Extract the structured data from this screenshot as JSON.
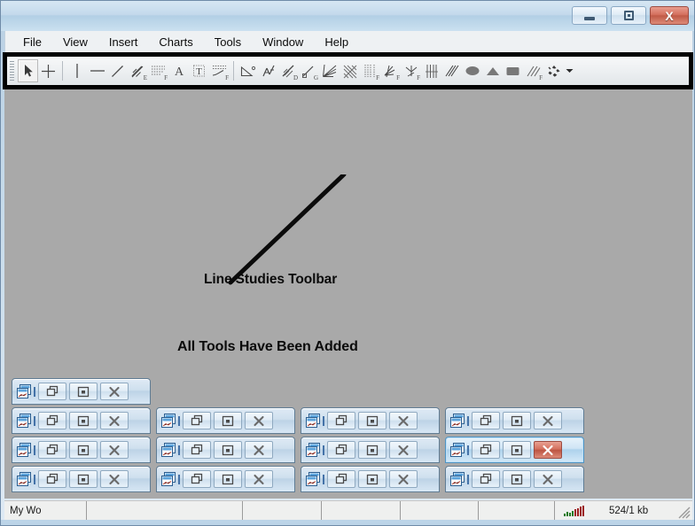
{
  "window": {
    "title": "",
    "controls": [
      {
        "name": "minimize",
        "glyph": "minimize"
      },
      {
        "name": "maximize",
        "glyph": "maximize"
      },
      {
        "name": "close",
        "glyph": "close",
        "label": "X",
        "color": "#c05a46"
      }
    ]
  },
  "menu": {
    "items": [
      {
        "label": "File"
      },
      {
        "label": "View"
      },
      {
        "label": "Insert"
      },
      {
        "label": "Charts"
      },
      {
        "label": "Tools"
      },
      {
        "label": "Window"
      },
      {
        "label": "Help"
      }
    ]
  },
  "toolbar": {
    "name": "Line Studies Toolbar",
    "highlight_color": "#000000",
    "items": [
      {
        "icon": "cursor-arrow-icon",
        "label": "Cursor",
        "selected": true
      },
      {
        "icon": "crosshair-icon",
        "label": "Crosshair",
        "selected": false
      },
      {
        "sep": true
      },
      {
        "icon": "vertical-line-icon",
        "label": "Vertical Line",
        "selected": false
      },
      {
        "icon": "horizontal-line-icon",
        "label": "Horizontal Line",
        "selected": false
      },
      {
        "icon": "trendline-icon",
        "label": "Trendline",
        "selected": false
      },
      {
        "icon": "trendline-by-angle-icon",
        "label": "Trendline By Angle",
        "sub": "E",
        "selected": false
      },
      {
        "icon": "equidistant-channel-icon",
        "label": "Equidistant Channel",
        "sub": "F",
        "selected": false
      },
      {
        "icon": "text-icon",
        "label": "Text",
        "selected": false
      },
      {
        "icon": "text-label-icon",
        "label": "Text Label",
        "selected": false
      },
      {
        "icon": "arrowed-line-icon",
        "label": "Arrowed Line",
        "sub": "F",
        "selected": false
      },
      {
        "sep": true
      },
      {
        "icon": "angle-icon",
        "label": "Angle",
        "selected": false
      },
      {
        "icon": "andrews-pitchfork-icon",
        "label": "Andrews Pitchfork",
        "selected": false
      },
      {
        "icon": "linear-regression-channel-icon",
        "label": "Linear Regression Channel",
        "sub": "D",
        "selected": false
      },
      {
        "icon": "standard-deviation-channel-icon",
        "label": "Standard Deviation Channel",
        "sub": "G",
        "selected": false
      },
      {
        "icon": "fibonacci-fan-icon",
        "label": "Fibonacci Fan",
        "selected": false
      },
      {
        "icon": "fibonacci-arcs-icon",
        "label": "Fibonacci Arcs",
        "selected": false
      },
      {
        "icon": "fibonacci-time-zones-icon",
        "label": "Fibonacci Time Zones",
        "sub": "F",
        "selected": false
      },
      {
        "icon": "fibonacci-expansion-icon",
        "label": "Fibonacci Expansion",
        "sub": "F",
        "selected": false
      },
      {
        "icon": "fibonacci-channel-icon",
        "label": "Fibonacci Channel",
        "sub": "F",
        "selected": false
      },
      {
        "icon": "gann-grid-icon",
        "label": "Gann Grid",
        "selected": false
      },
      {
        "icon": "gann-fan-icon",
        "label": "Gann Fan",
        "selected": false
      },
      {
        "icon": "ellipse-icon",
        "label": "Ellipse",
        "selected": false
      },
      {
        "icon": "triangle-icon",
        "label": "Triangle",
        "selected": false
      },
      {
        "icon": "rectangle-icon",
        "label": "Rectangle",
        "selected": false
      },
      {
        "icon": "cycle-lines-icon",
        "label": "Cycle Lines",
        "sub": "F",
        "selected": false
      },
      {
        "icon": "arrows-icon",
        "label": "Arrows",
        "selected": false
      },
      {
        "icon": "chevron-down-icon",
        "label": "More Tools",
        "selected": false
      }
    ]
  },
  "annotations": [
    {
      "text": "Line Studies Toolbar"
    },
    {
      "text": "All Tools Have Been Added"
    }
  ],
  "mdi_windows": {
    "button_labels": {
      "restore": "Restore",
      "maximize": "Maximize",
      "close": "Close"
    },
    "rows": [
      [
        {
          "active": false
        }
      ],
      [
        {
          "active": false
        },
        {
          "active": false
        },
        {
          "active": false
        },
        {
          "active": false
        }
      ],
      [
        {
          "active": false
        },
        {
          "active": false
        },
        {
          "active": false
        },
        {
          "active": true
        }
      ],
      [
        {
          "active": false
        },
        {
          "active": false
        },
        {
          "active": false
        },
        {
          "active": false
        }
      ]
    ]
  },
  "statusbar": {
    "cells": [
      "My Wo",
      "",
      "",
      "",
      "",
      ""
    ],
    "traffic": "524/1 kb",
    "signal_bars": [
      3,
      5,
      4,
      6,
      8,
      9,
      11,
      12
    ]
  }
}
